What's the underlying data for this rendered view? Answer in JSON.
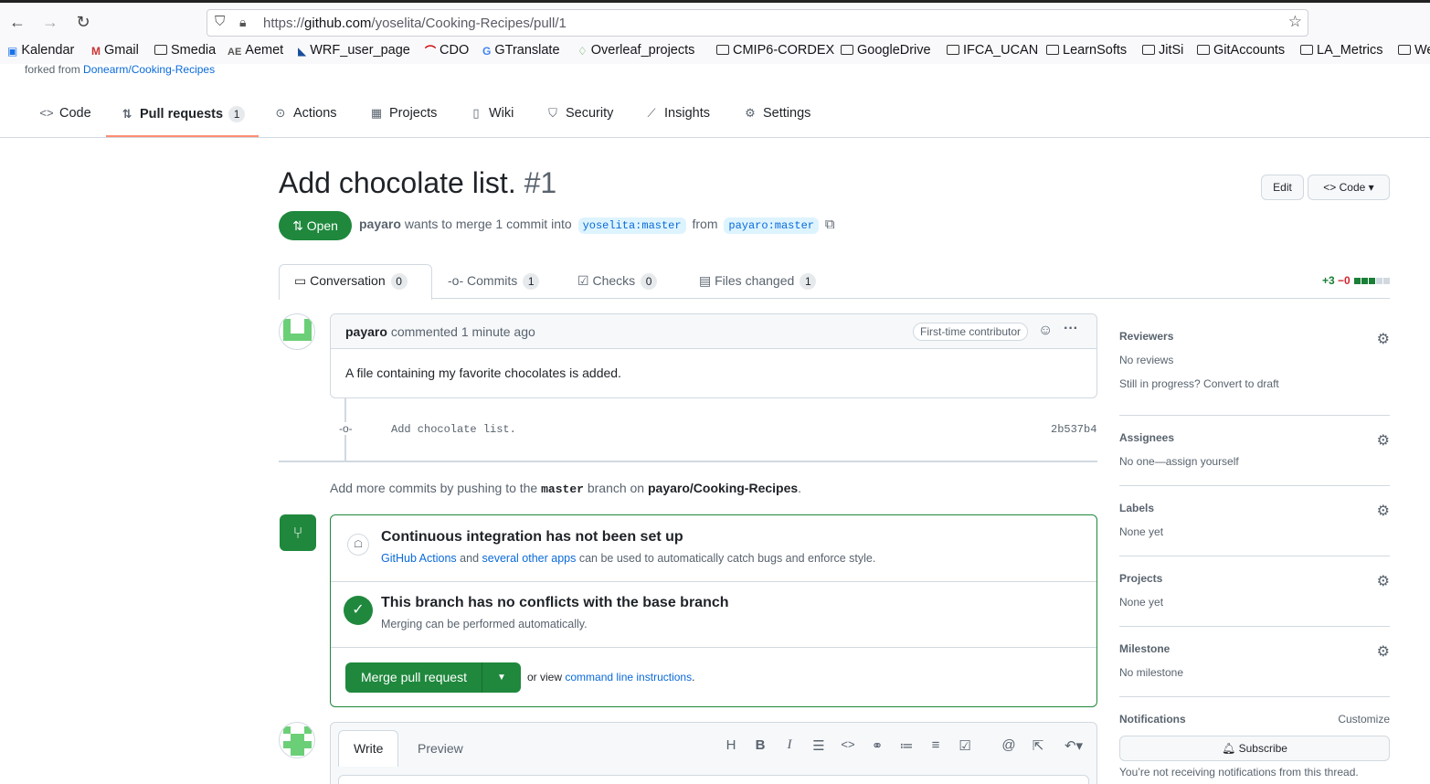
{
  "browser": {
    "url_prefix": "https://",
    "url_domain": "github.com",
    "url_path": "/yoselita/Cooking-Recipes/pull/1",
    "bookmarks": [
      "Kalendar",
      "Gmail",
      "Smedia",
      "Aemet",
      "WRF_user_page",
      "CDO",
      "GTranslate",
      "Overleaf_projects",
      "CMIP6-CORDEX",
      "GoogleDrive",
      "IFCA_UCAN",
      "LearnSofts",
      "JitSi",
      "GitAccounts",
      "LA_Metrics",
      "We"
    ]
  },
  "repo": {
    "forked_prefix": "forked from",
    "forked_link": "Donearm/Cooking-Recipes",
    "tabs": [
      {
        "label": "Code",
        "count": ""
      },
      {
        "label": "Pull requests",
        "count": "1"
      },
      {
        "label": "Actions",
        "count": ""
      },
      {
        "label": "Projects",
        "count": ""
      },
      {
        "label": "Wiki",
        "count": ""
      },
      {
        "label": "Security",
        "count": ""
      },
      {
        "label": "Insights",
        "count": ""
      },
      {
        "label": "Settings",
        "count": ""
      }
    ]
  },
  "pr": {
    "title": "Add chocolate list.",
    "number": "#1",
    "edit_label": "Edit",
    "code_label": "Code",
    "state": "Open",
    "author": "payaro",
    "meta_text": "wants to merge 1 commit into",
    "base_branch": "yoselita:master",
    "from_text": "from",
    "head_branch": "payaro:master",
    "tabs": [
      {
        "label": "Conversation",
        "count": "0"
      },
      {
        "label": "Commits",
        "count": "1"
      },
      {
        "label": "Checks",
        "count": "0"
      },
      {
        "label": "Files changed",
        "count": "1"
      }
    ],
    "diff_add": "+3",
    "diff_del": "−0"
  },
  "comment": {
    "author": "payaro",
    "action": "commented 1 minute ago",
    "badge": "First-time contributor",
    "body": "A file containing my favorite chocolates is added."
  },
  "commit": {
    "message": "Add chocolate list.",
    "sha": "2b537b4"
  },
  "hint": {
    "prefix": "Add more commits by pushing to the",
    "branch": "master",
    "middle": "branch on",
    "repo": "payaro/Cooking-Recipes",
    "suffix": "."
  },
  "merge": {
    "ci_title": "Continuous integration has not been set up",
    "ci_link1": "GitHub Actions",
    "ci_and": "and",
    "ci_link2": "several other apps",
    "ci_rest": "can be used to automatically catch bugs and enforce style.",
    "conflict_title": "This branch has no conflicts with the base branch",
    "conflict_sub": "Merging can be performed automatically.",
    "merge_button": "Merge pull request",
    "or_view": "or view",
    "cli_link": "command line instructions",
    "cli_suffix": "."
  },
  "write": {
    "write_tab": "Write",
    "preview_tab": "Preview"
  },
  "sidebar": {
    "reviewers": {
      "title": "Reviewers",
      "value": "No reviews",
      "extra": "Still in progress? Convert to draft"
    },
    "assignees": {
      "title": "Assignees",
      "value": "No one—assign yourself"
    },
    "labels": {
      "title": "Labels",
      "value": "None yet"
    },
    "projects": {
      "title": "Projects",
      "value": "None yet"
    },
    "milestone": {
      "title": "Milestone",
      "value": "No milestone"
    },
    "notifications": {
      "title": "Notifications",
      "customize": "Customize",
      "subscribe": "Subscribe",
      "note": "You’re not receiving notifications from this thread."
    }
  }
}
